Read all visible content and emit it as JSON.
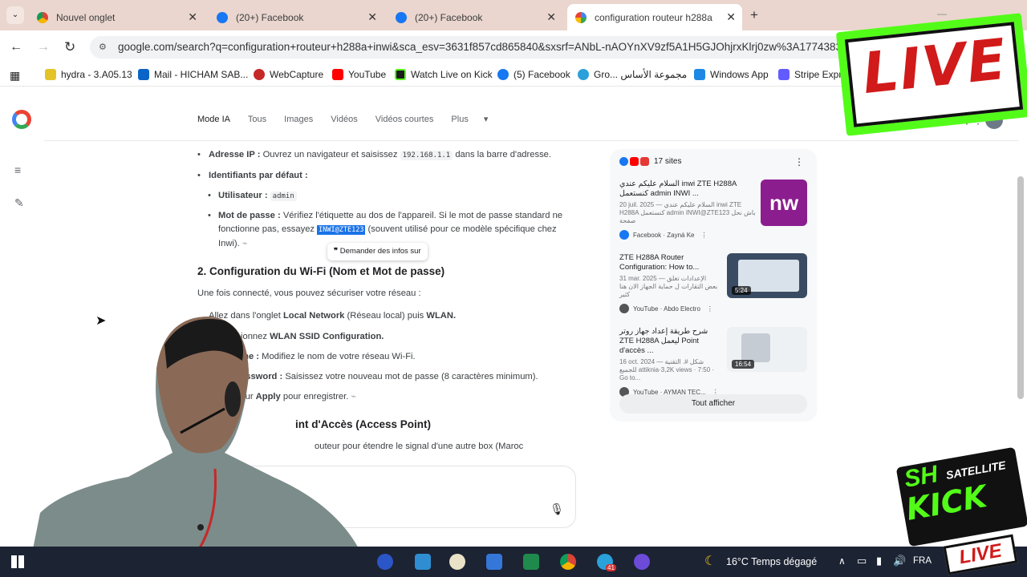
{
  "browser": {
    "tabs": [
      {
        "label": "Nouvel onglet",
        "icon": "chrome-icon",
        "active": false
      },
      {
        "label": "(20+) Facebook",
        "icon": "facebook-icon",
        "active": false
      },
      {
        "label": "(20+) Facebook",
        "icon": "facebook-icon",
        "active": false
      },
      {
        "label": "configuration routeur h288a in",
        "icon": "google-icon",
        "active": true
      }
    ],
    "url": "google.com/search?q=configuration+routeur+h288a+inwi&sca_esv=3631f857cd865840&sxsrf=ANbL-nAOYnXV9zf5A1H5GJOhjrxKlrj0zw%3A1774383161...",
    "bookmarks": [
      "hydra - 3.A05.13",
      "Mail - HICHAM SAB...",
      "WebCapture",
      "YouTube",
      "Watch Live on Kick",
      "(5) Facebook",
      "Gro... مجموعة الأساس",
      "Windows App",
      "Stripe Express"
    ]
  },
  "search_nav": {
    "items": [
      "Mode IA",
      "Tous",
      "Images",
      "Vidéos",
      "Vidéos courtes",
      "Plus"
    ]
  },
  "article": {
    "ip_label": "Adresse IP :",
    "ip_text_before": "Ouvrez un navigateur et saisissez",
    "ip_code": "192.168.1.1",
    "ip_text_after": "dans la barre d'adresse.",
    "ids_label": "Identifiants par défaut :",
    "user_label": "Utilisateur :",
    "user_code": "admin",
    "pass_label": "Mot de passe :",
    "pass_text_before": "Vérifiez l'étiquette au dos de l'appareil. Si le mot de passe standard ne fonctionne pas, essayez",
    "pass_code": "INWI@ZTE123",
    "pass_text_after": "(souvent utilisé pour ce modèle spécifique chez Inwi).",
    "ask_tooltip": "Demander des infos sur",
    "section2_title": "2. Configuration du Wi-Fi (Nom et Mot de passe)",
    "section2_intro": "Une fois connecté, vous pouvez sécuriser votre réseau :",
    "step1_a": "Allez dans l'onglet",
    "step1_b": "Local Network",
    "step1_c": "(Réseau local) puis",
    "step1_d": "WLAN.",
    "step2_a": "ionnez",
    "step2_b": "WLAN SSID Configuration.",
    "step3_a": "me :",
    "step3_b": "Modifiez le nom de votre réseau Wi-Fi.",
    "step4_a": "assword :",
    "step4_b": "Saisissez votre nouveau mot de passe (8 caractères minimum).",
    "step5_a": "sur",
    "step5_b": "Apply",
    "step5_c": "pour enregistrer.",
    "section3_title": "int d'Accès (Access Point)",
    "section3_text": "outeur pour étendre le signal d'une autre box (Maroc"
  },
  "sources": {
    "count": "17 sites",
    "items": [
      {
        "title": "السلام عليكم عندي inwi ZTE H288A كنستعمل admin INWI ...",
        "desc": "20 juil. 2025 — السلام عليكم عندي inwi ZTE H288A كنستعمل admin INWI@ZTE123 باش نحل صفحة",
        "by": "Facebook · Zayná Ke",
        "thumb_text": "nw"
      },
      {
        "title": "ZTE H288A Router Configuration: How to...",
        "desc": "31 mar. 2025 — الإعدادات تغلق بعض التقارات ل حماية الجهاز الان هنا كثير",
        "by": "YouTube · Abdo Electro",
        "duration": "5:24"
      },
      {
        "title": "شرح طريقة إعداد جهاز روتر ZTE H288A ليعمل Point d'accès ...",
        "desc": "16 oct. 2024 — شكل #. التقنية للجميع attiknia·3,2K views · 7:50 · Go to...",
        "by": "YouTube · AYMAN TEC...",
        "duration": "16:54"
      }
    ],
    "show_all": "Tout afficher"
  },
  "overlays": {
    "live_badge": "LIVE",
    "kick_logo": "KICK",
    "kick_sub": "SATELLITE",
    "kick_live": "LIVE",
    "kick_sh": "SH"
  },
  "taskbar": {
    "weather": "16°C Temps dégagé",
    "lang": "FRA",
    "badge": "41"
  },
  "colors": {
    "accent": "#1a73e8",
    "live_green": "#53fc18",
    "live_red": "#d11a1a"
  }
}
